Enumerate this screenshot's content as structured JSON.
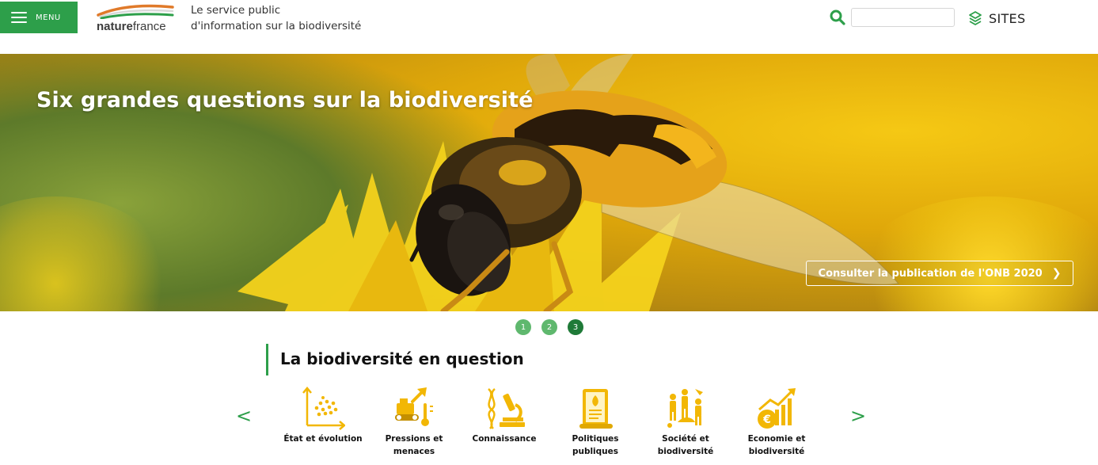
{
  "header": {
    "menu_label": "MENU",
    "logo": {
      "part1": "nature",
      "part2": "france"
    },
    "tagline_line1": "Le service public",
    "tagline_line2": "d'information sur la biodiversité",
    "search": {
      "placeholder": ""
    },
    "sites_label": "SITES"
  },
  "hero": {
    "title": "Six grandes questions sur la biodiversité",
    "cta_label": "Consulter la publication de l'ONB 2020",
    "cta_chevron": "❯"
  },
  "pager": {
    "dots": [
      "1",
      "2",
      "3"
    ],
    "active_index": 2
  },
  "section": {
    "title": "La biodiversité en question",
    "prev_arrow": "<",
    "next_arrow": ">",
    "categories": [
      {
        "label": "État et évolution",
        "icon": "chart-dots-icon"
      },
      {
        "label": "Pressions et menaces",
        "icon": "bulldozer-icon"
      },
      {
        "label": "Connaissance",
        "icon": "microscope-dna-icon"
      },
      {
        "label": "Politiques publiques",
        "icon": "scroll-document-icon"
      },
      {
        "label": "Société et biodiversité",
        "icon": "people-icon"
      },
      {
        "label": "Economie et biodiversité",
        "icon": "euro-growth-icon"
      }
    ]
  },
  "colors": {
    "green": "#2d9f4a",
    "dark_green": "#1f7a38",
    "icon_yellow": "#f2b705"
  }
}
